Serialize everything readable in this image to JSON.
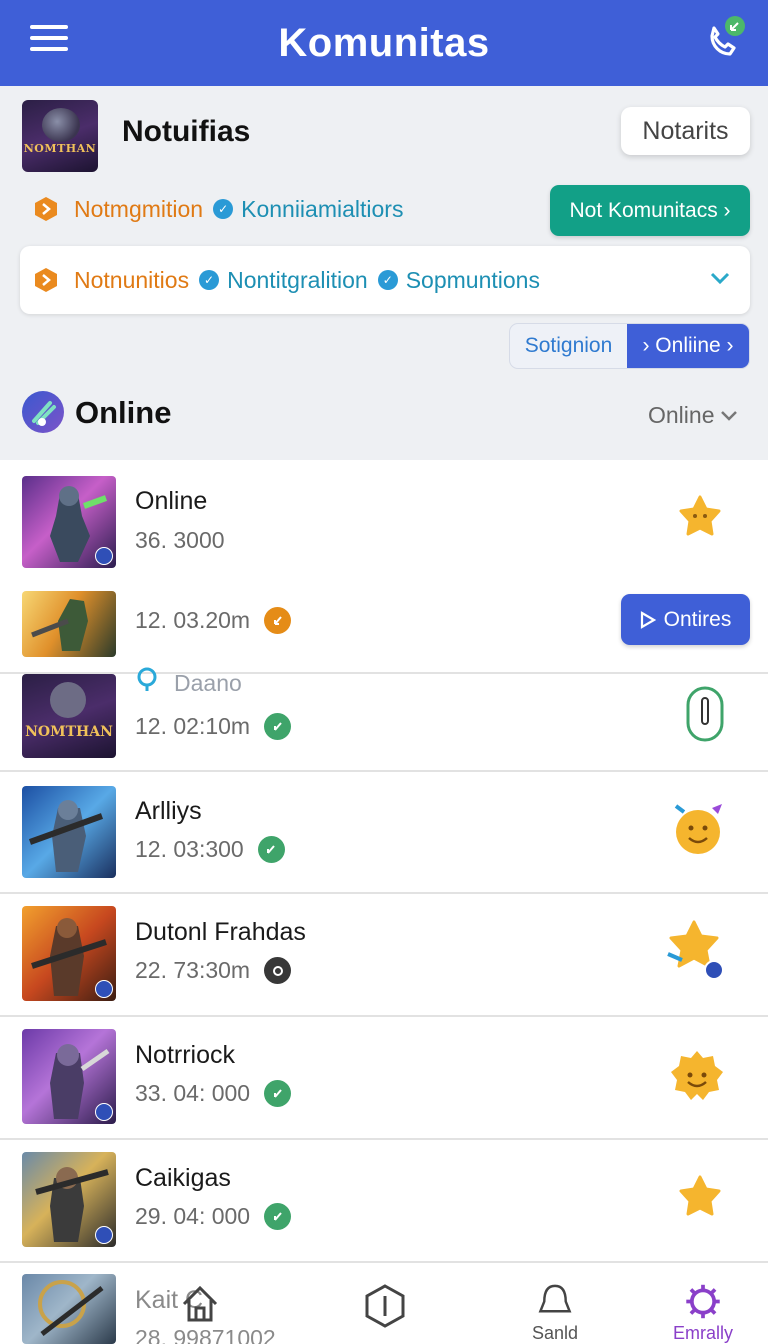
{
  "appbar": {
    "title": "Komunitas",
    "menu_icon": "menu-icon",
    "call_icon": "phone-icon"
  },
  "header": {
    "title": "Notuifias",
    "logo_text": "NOMTHAN",
    "notarits_button": "Notarits",
    "row1": {
      "left": "Notmgmition",
      "right": "Konniiamialtiors"
    },
    "teal_button": "Not Komunitacs ›",
    "dropdown": {
      "a": "Notnunitios",
      "b": "Nontitgralition",
      "c": "Sopmuntions"
    },
    "segment": {
      "a": "Sotignion",
      "b": "› Onliine ›"
    }
  },
  "section": {
    "title": "Online",
    "filter": "Online"
  },
  "list": [
    {
      "name": "Online",
      "sub": "36. 3000",
      "status": "",
      "action": "star"
    },
    {
      "name": "",
      "sub": "12. 03.20m",
      "status": "orange",
      "action": "button",
      "button_label": "Ontires"
    },
    {
      "name": "Daano",
      "sub": "12. 02:10m",
      "status": "green",
      "action": "toggle"
    },
    {
      "name": "Arlliys",
      "sub": "12. 03:300",
      "status": "green",
      "action": "smiley"
    },
    {
      "name": "Dutonl Frahdas",
      "sub": "22. 73:30m",
      "status": "dark",
      "action": "star-badge"
    },
    {
      "name": "Notrriock",
      "sub": "33. 04: 000",
      "status": "green",
      "action": "smiley"
    },
    {
      "name": "Caikigas",
      "sub": "29. 04: 000",
      "status": "green",
      "action": "star"
    },
    {
      "name": "Kait C",
      "sub": "28. 99871002",
      "status": "",
      "action": ""
    }
  ],
  "bottomnav": [
    {
      "label": "",
      "icon": "home-icon"
    },
    {
      "label": "",
      "icon": "hexagon-icon"
    },
    {
      "label": "Sanld",
      "icon": "bell-icon"
    },
    {
      "label": "Emrally",
      "icon": "gear-icon",
      "active_color": "#8a3fc9"
    }
  ],
  "colors": {
    "primary": "#3f5fd7",
    "teal": "#12a087",
    "star": "#f5b52e",
    "green": "#3fa46a"
  }
}
